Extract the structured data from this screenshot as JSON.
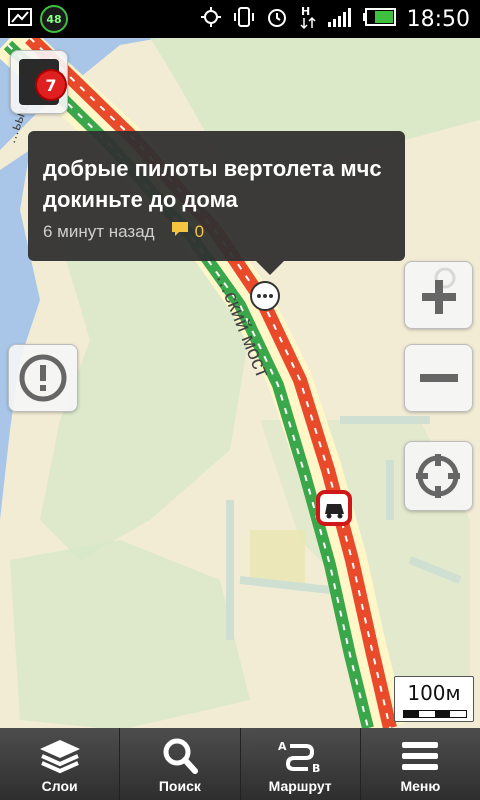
{
  "status_bar": {
    "battery_badge": "48",
    "time": "18:50"
  },
  "map": {
    "road_label": "…ский мост",
    "left_label": "…ьышева"
  },
  "traffic": {
    "level": "7"
  },
  "event_popup": {
    "text": "добрые пилоты вертолета мчс докиньте до дома",
    "time_ago": "6 минут назад",
    "comments_count": "0"
  },
  "scale": {
    "label": "100м"
  },
  "bottom_bar": {
    "tabs": [
      {
        "label": "Слои",
        "icon": "layers-icon"
      },
      {
        "label": "Поиск",
        "icon": "search-icon"
      },
      {
        "label": "Маршрут",
        "icon": "route-icon"
      },
      {
        "label": "Меню",
        "icon": "menu-icon"
      }
    ]
  },
  "colors": {
    "traffic_jam": "#e84a2a",
    "traffic_free": "#3aa84a",
    "water": "#a9c6e8",
    "land": "#f3ecd5"
  }
}
